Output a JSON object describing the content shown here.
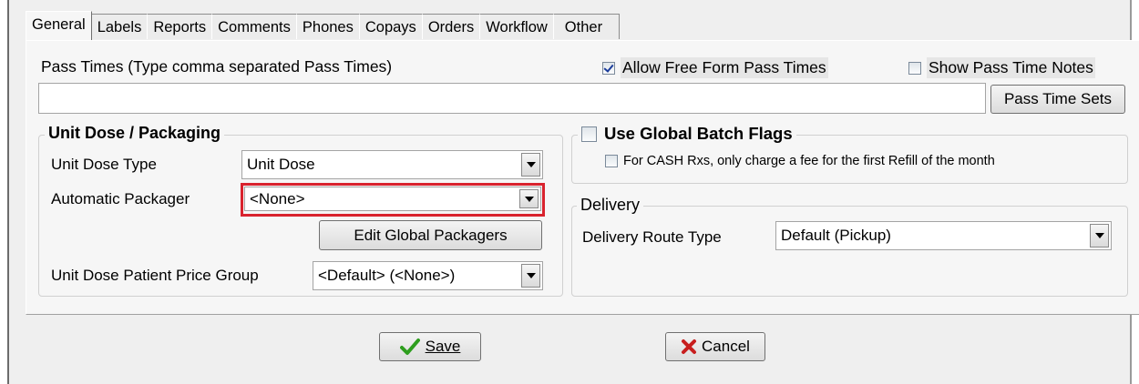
{
  "tabs": [
    {
      "label": "General"
    },
    {
      "label": "Labels"
    },
    {
      "label": "Reports"
    },
    {
      "label": "Comments"
    },
    {
      "label": "Phones"
    },
    {
      "label": "Copays"
    },
    {
      "label": "Orders"
    },
    {
      "label": "Workflow"
    },
    {
      "label": "Other"
    }
  ],
  "pass_times": {
    "label": "Pass Times (Type comma separated Pass Times)",
    "value": "",
    "allow_free_form": {
      "label": "Allow Free Form Pass Times",
      "checked": true
    },
    "show_notes": {
      "label": "Show Pass Time Notes",
      "checked": false
    },
    "sets_button": "Pass Time Sets"
  },
  "unit_dose": {
    "title": "Unit Dose / Packaging",
    "type_label": "Unit Dose Type",
    "type_value": "Unit Dose",
    "packager_label": "Automatic Packager",
    "packager_value": "<None>",
    "edit_button": "Edit Global Packagers",
    "price_group_label": "Unit Dose Patient Price Group",
    "price_group_value": "<Default> (<None>)"
  },
  "batch_flags": {
    "title": "Use Global Batch Flags",
    "checked": false,
    "cash_rx": {
      "label": "For CASH Rxs, only charge a fee for the first Refill of the month",
      "checked": false
    }
  },
  "delivery": {
    "title": "Delivery",
    "route_label": "Delivery Route Type",
    "route_value": "Default (Pickup)"
  },
  "footer": {
    "save_label": "Save",
    "cancel_label": "Cancel"
  },
  "colors": {
    "highlight": "#d9232e",
    "save_check": "#2e9e1e",
    "cancel_x": "#c81e1e"
  }
}
